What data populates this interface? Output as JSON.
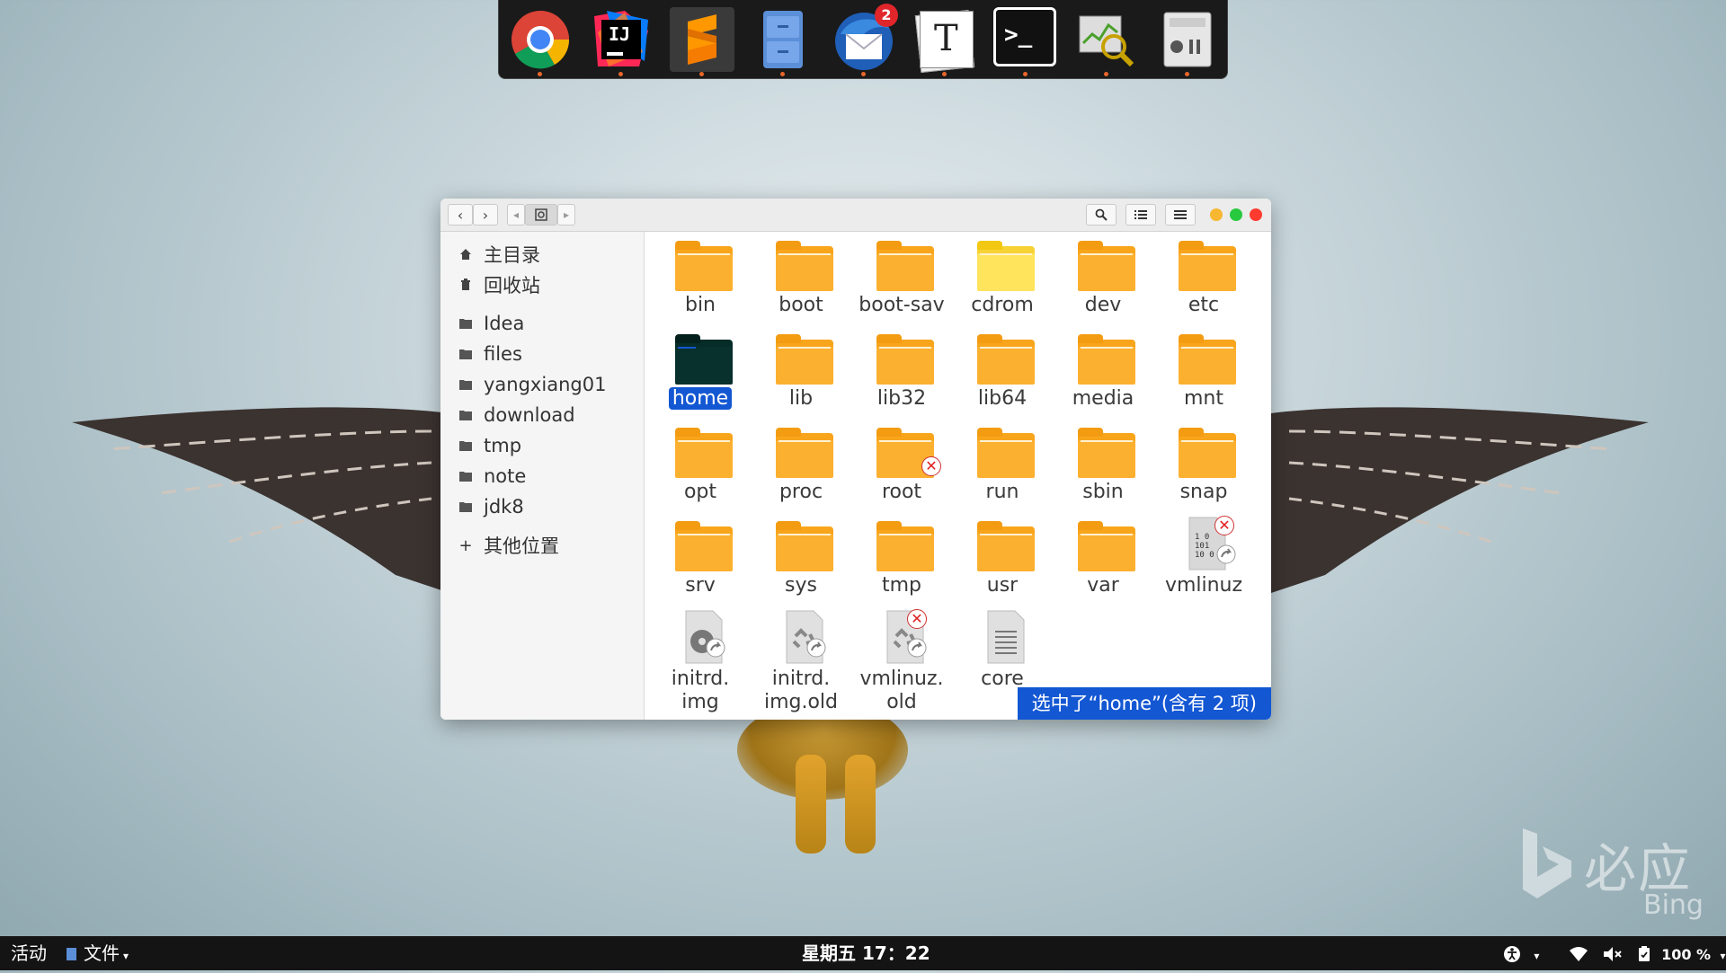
{
  "dock": {
    "items": [
      {
        "name": "chrome"
      },
      {
        "name": "intellij-idea",
        "label": "IJ"
      },
      {
        "name": "sublime-text",
        "label": "S"
      },
      {
        "name": "file-cabinet"
      },
      {
        "name": "thunderbird",
        "badge": "2"
      },
      {
        "name": "typora",
        "label": "T"
      },
      {
        "name": "terminal",
        "label": ">_"
      },
      {
        "name": "system-monitor"
      },
      {
        "name": "settings"
      }
    ]
  },
  "window": {
    "sidebar": {
      "places": [
        {
          "label": "主目录",
          "icon": "home-icon"
        },
        {
          "label": "回收站",
          "icon": "trash-icon"
        }
      ],
      "bookmarks": [
        "Idea",
        "files",
        "yangxiang01",
        "download",
        "tmp",
        "note",
        "jdk8"
      ],
      "other": "其他位置",
      "other_prefix": "+"
    },
    "files": [
      {
        "name": "bin",
        "type": "folder"
      },
      {
        "name": "boot",
        "type": "folder"
      },
      {
        "name": "boot-sav",
        "type": "folder"
      },
      {
        "name": "cdrom",
        "type": "folder-light"
      },
      {
        "name": "dev",
        "type": "folder"
      },
      {
        "name": "etc",
        "type": "folder"
      },
      {
        "name": "home",
        "type": "folder-selected"
      },
      {
        "name": "lib",
        "type": "folder"
      },
      {
        "name": "lib32",
        "type": "folder"
      },
      {
        "name": "lib64",
        "type": "folder"
      },
      {
        "name": "media",
        "type": "folder"
      },
      {
        "name": "mnt",
        "type": "folder"
      },
      {
        "name": "opt",
        "type": "folder"
      },
      {
        "name": "proc",
        "type": "folder"
      },
      {
        "name": "root",
        "type": "folder-locked"
      },
      {
        "name": "run",
        "type": "folder"
      },
      {
        "name": "sbin",
        "type": "folder"
      },
      {
        "name": "snap",
        "type": "folder"
      },
      {
        "name": "srv",
        "type": "folder"
      },
      {
        "name": "sys",
        "type": "folder"
      },
      {
        "name": "tmp",
        "type": "folder"
      },
      {
        "name": "usr",
        "type": "folder"
      },
      {
        "name": "var",
        "type": "folder"
      },
      {
        "name": "vmlinuz",
        "type": "binary-link-broken"
      },
      {
        "name1": "initrd.",
        "name2": "img",
        "type": "disk-link"
      },
      {
        "name1": "initrd.",
        "name2": "img.old",
        "type": "archive-link"
      },
      {
        "name1": "vmlinuz.",
        "name2": "old",
        "type": "archive-link-broken"
      },
      {
        "name": "core",
        "type": "text"
      }
    ],
    "status": "选中了“home”(含有 2 项)"
  },
  "panel": {
    "activities": "活动",
    "app_menu": "文件",
    "clock": "星期五 17：22",
    "battery": "100 %"
  },
  "watermark": {
    "line1": "必应",
    "line2": "Bing"
  }
}
